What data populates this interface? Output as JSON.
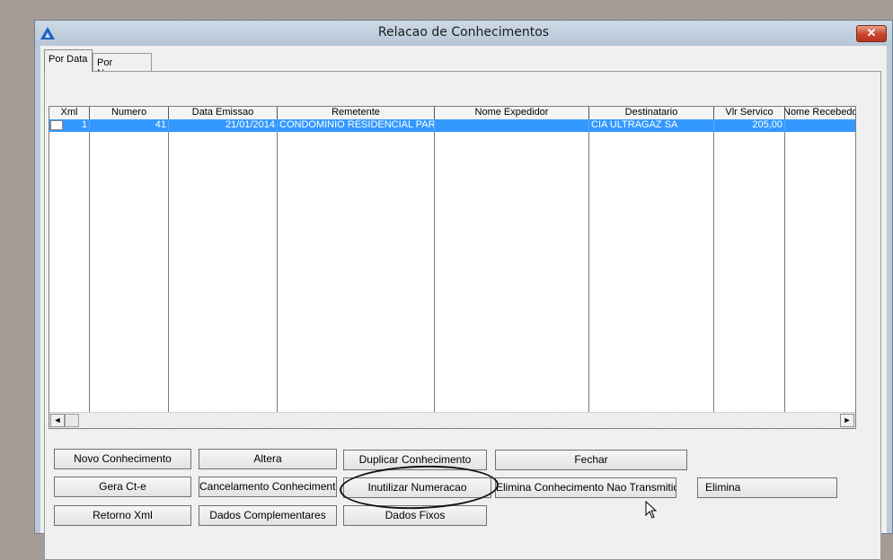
{
  "window": {
    "title": "Relacao de Conhecimentos",
    "close_glyph": "✕"
  },
  "tabs": [
    {
      "label": "Por Data",
      "active": true
    },
    {
      "label": "Por Numero",
      "active": false
    }
  ],
  "grid": {
    "columns": [
      "Xml",
      "Numero",
      "Data Emissao",
      "Remetente",
      "Nome Expedidor",
      "Destinatario",
      "Vlr Servico",
      "Nome Recebedor"
    ],
    "rows": [
      {
        "xml": "1",
        "numero": "41",
        "data_emissao": "21/01/2014",
        "remetente": "CONDOMINIO RESIDENCIAL PARI",
        "nome_expedidor": "",
        "destinatario": "CIA ULTRAGAZ SA",
        "vlr_servico": "205,00",
        "nome_recebedor": ""
      }
    ],
    "selected_row_color": "#3399ff"
  },
  "scrollbar": {
    "left_arrow": "◄",
    "right_arrow": "►"
  },
  "buttons": {
    "novo_conhecimento": "Novo Conhecimento",
    "altera": "Altera",
    "duplicar_conhecimento": "Duplicar Conhecimento",
    "fechar": "Fechar",
    "gera_cte": "Gera Ct-e",
    "cancelamento_conhecimento": "Cancelamento Conhecimento",
    "inutilizar_numeracao": "Inutilizar Numeracao",
    "elimina_nao_transmitido": "Elimina Conhecimento Nao Transmitido",
    "elimina": "Elimina",
    "retorno_xml": "Retorno Xml",
    "dados_complementares": "Dados Complementares",
    "dados_fixos": "Dados Fixos"
  },
  "icons": {
    "app": "app-triangle-icon",
    "close": "close-icon",
    "cursor": "mouse-pointer-icon"
  }
}
